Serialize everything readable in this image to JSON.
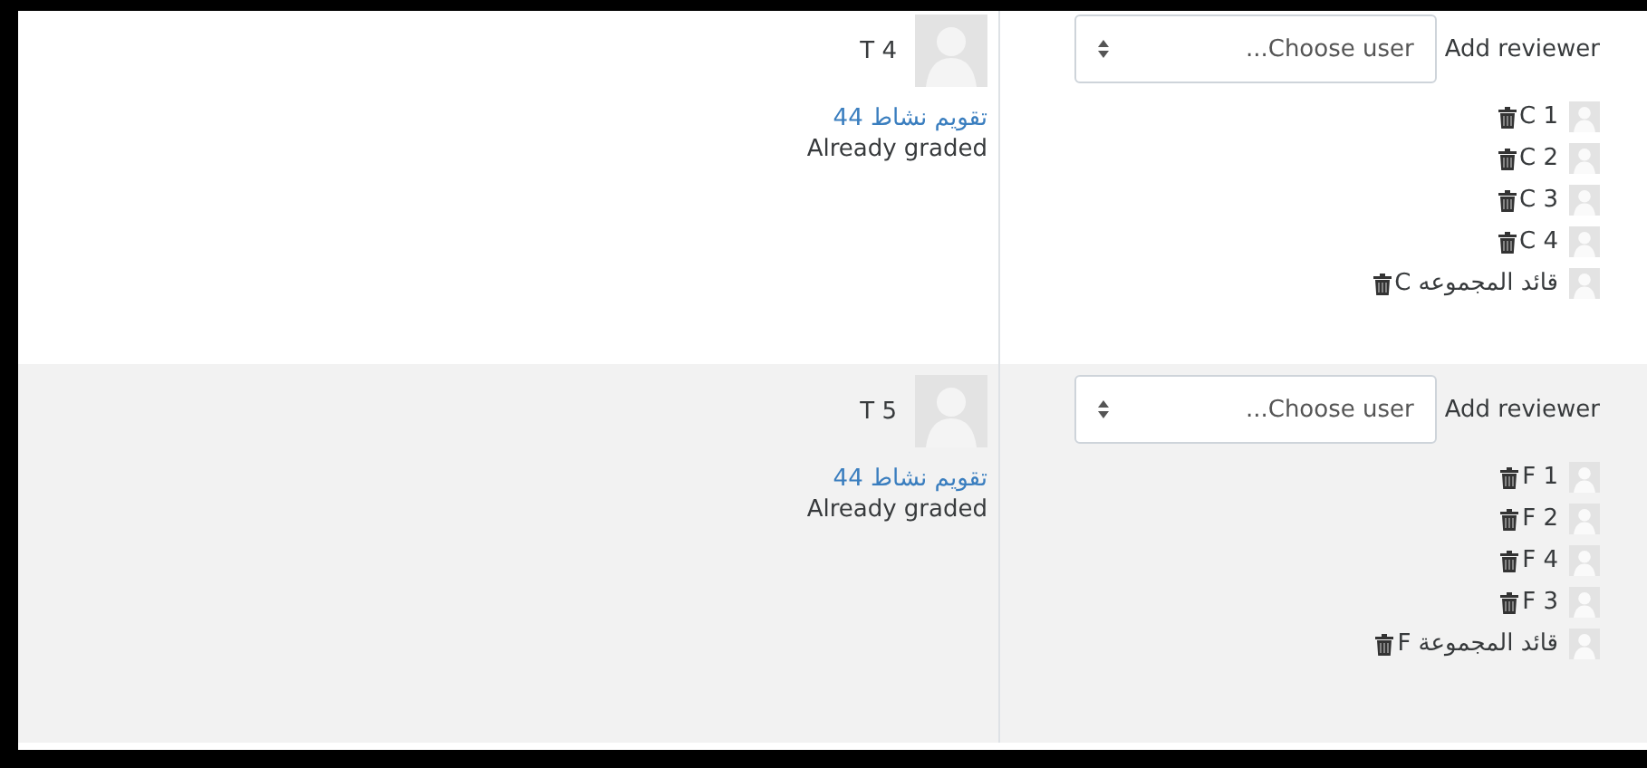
{
  "rows": [
    {
      "author": "T 4",
      "link": "تقويم نشاط 44",
      "status": "Already graded",
      "add_label": "Add reviewer",
      "select": {
        "placeholder": "...Choose user"
      },
      "reviewers": [
        {
          "name": "C 1"
        },
        {
          "name": "C 2"
        },
        {
          "name": "C 3"
        },
        {
          "name": "C 4"
        },
        {
          "name": "قائد المجموعه C"
        }
      ]
    },
    {
      "author": "T 5",
      "link": "تقويم نشاط 44",
      "status": "Already graded",
      "add_label": "Add reviewer",
      "select": {
        "placeholder": "...Choose user"
      },
      "reviewers": [
        {
          "name": "F 1"
        },
        {
          "name": "F 2"
        },
        {
          "name": "F 4"
        },
        {
          "name": "F 3"
        },
        {
          "name": "قائد المجموعة F"
        }
      ]
    }
  ]
}
